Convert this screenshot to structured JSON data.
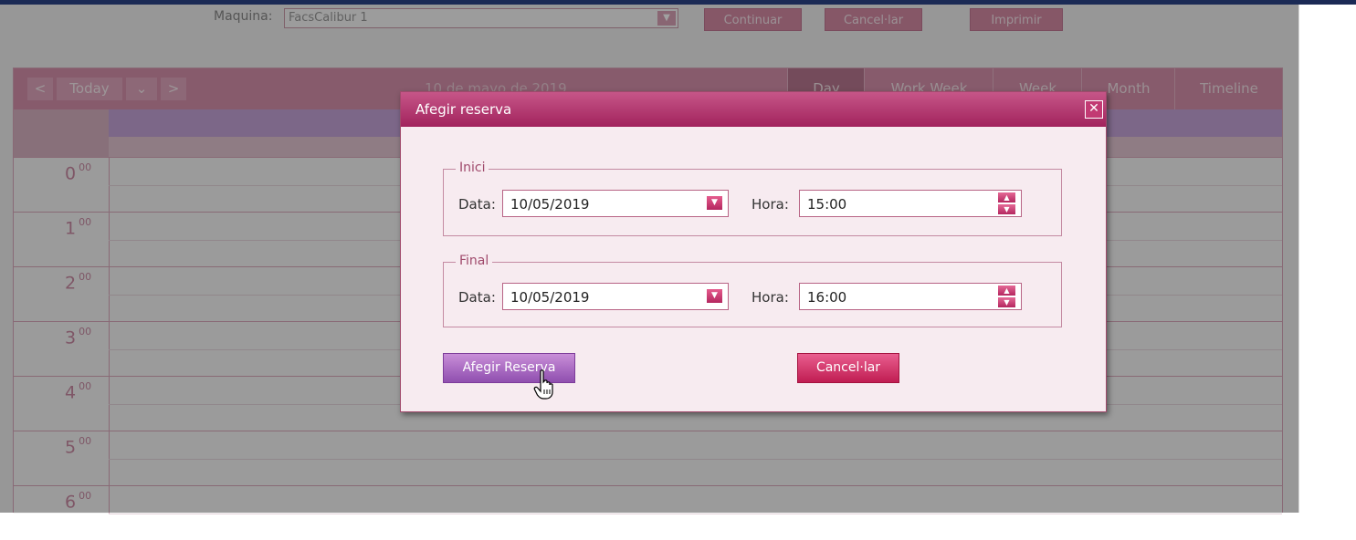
{
  "toolbar": {
    "machine_label": "Maquina:",
    "machine_value": "FacsCalibur 1",
    "continue_label": "Continuar",
    "cancel_label": "Cancel·lar",
    "print_label": "Imprimir"
  },
  "calendar": {
    "prev_icon": "chevron-left",
    "today_label": "Today",
    "next_icon": "chevron-right",
    "date_title": "10 de mayo de 2019",
    "views": [
      "Day",
      "Work Week",
      "Week",
      "Month",
      "Timeline"
    ],
    "active_view": "Day",
    "hours": [
      {
        "h": "0",
        "m": "00"
      },
      {
        "h": "1",
        "m": "00"
      },
      {
        "h": "2",
        "m": "00"
      },
      {
        "h": "3",
        "m": "00"
      },
      {
        "h": "4",
        "m": "00"
      },
      {
        "h": "5",
        "m": "00"
      },
      {
        "h": "6",
        "m": "00"
      }
    ]
  },
  "dialog": {
    "title": "Afegir reserva",
    "close_icon": "close-icon",
    "start": {
      "legend": "Inici",
      "date_label": "Data:",
      "date_value": "10/05/2019",
      "time_label": "Hora:",
      "time_value": "15:00"
    },
    "end": {
      "legend": "Final",
      "date_label": "Data:",
      "date_value": "10/05/2019",
      "time_label": "Hora:",
      "time_value": "16:00"
    },
    "submit_label": "Afegir Reserva",
    "cancel_label": "Cancel·lar"
  },
  "colors": {
    "accent": "#b4275f",
    "title_bar": "#a2235d",
    "primary_button": "#8f4faf"
  }
}
